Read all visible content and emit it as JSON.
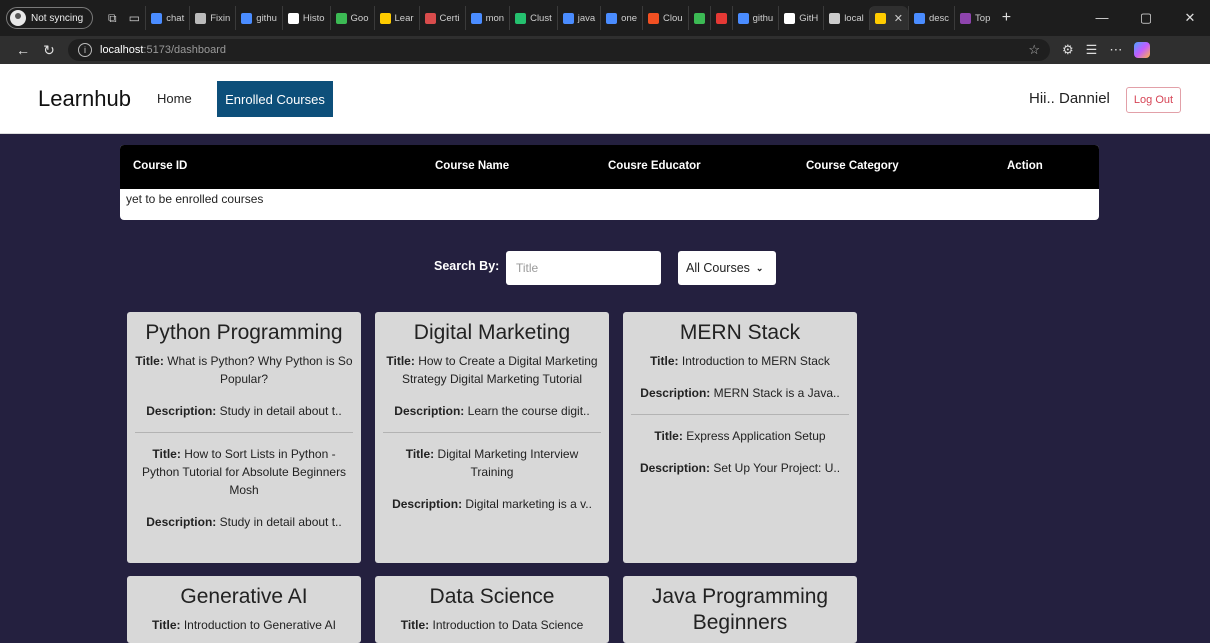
{
  "browser": {
    "profile_label": "Not syncing",
    "tabs": [
      {
        "label": "chat",
        "color": "#4a8cff"
      },
      {
        "label": "Fixin",
        "color": "#bbbbbb"
      },
      {
        "label": "githu",
        "color": "#4a8cff"
      },
      {
        "label": "Histo",
        "color": "#ffffff"
      },
      {
        "label": "Goo",
        "color": "#3cba54"
      },
      {
        "label": "Lear",
        "color": "#ffcc00"
      },
      {
        "label": "Certi",
        "color": "#d94c4c"
      },
      {
        "label": "mon",
        "color": "#4a8cff"
      },
      {
        "label": "Clust",
        "color": "#25c16f"
      },
      {
        "label": "java",
        "color": "#4a8cff"
      },
      {
        "label": "one",
        "color": "#4a8cff"
      },
      {
        "label": "Clou",
        "color": "#f25022"
      },
      {
        "label": "",
        "color": "#3cba54"
      },
      {
        "label": "",
        "color": "#e53935"
      },
      {
        "label": "githu",
        "color": "#4a8cff"
      },
      {
        "label": "GitH",
        "color": "#ffffff"
      },
      {
        "label": "local",
        "color": "#cccccc"
      },
      {
        "label": "",
        "color": "#ffcc00",
        "active": true
      },
      {
        "label": "desc",
        "color": "#4a8cff"
      },
      {
        "label": "Top",
        "color": "#8e44ad"
      }
    ],
    "url_host": "localhost",
    "url_path": ":5173/dashboard"
  },
  "header": {
    "brand": "Learnhub",
    "nav_home": "Home",
    "nav_enrolled": "Enrolled Courses",
    "greeting": "Hii.. Danniel",
    "logout": "Log Out"
  },
  "table": {
    "headers": [
      "Course ID",
      "Course Name",
      "Cousre Educator",
      "Course Category",
      "Action"
    ],
    "empty_message": "yet to be enrolled courses"
  },
  "search": {
    "label": "Search By:",
    "placeholder": "Title",
    "select_value": "All Courses"
  },
  "labels": {
    "title": "Title:",
    "description": "Description:"
  },
  "courses": [
    {
      "name": "Python Programming",
      "lessons": [
        {
          "title": "What is Python? Why Python is So Popular?",
          "desc": "Study in detail about t.."
        },
        {
          "title": "How to Sort Lists in Python - Python Tutorial for Absolute Beginners Mosh",
          "desc": "Study in detail about t.."
        }
      ]
    },
    {
      "name": "Digital Marketing",
      "lessons": [
        {
          "title": "How to Create a Digital Marketing Strategy Digital Marketing Tutorial",
          "desc": "Learn the course digit.."
        },
        {
          "title": "Digital Marketing Interview Training",
          "desc": "Digital marketing is a v.."
        }
      ]
    },
    {
      "name": "MERN Stack",
      "lessons": [
        {
          "title": "Introduction to MERN Stack",
          "desc": "MERN Stack is a Java.."
        },
        {
          "title": "Express Application Setup",
          "desc": "Set Up Your Project: U.."
        }
      ]
    },
    {
      "name": "Generative AI",
      "lessons": [
        {
          "title": "Introduction to Generative AI",
          "desc": ""
        }
      ]
    },
    {
      "name": "Data Science",
      "lessons": [
        {
          "title": "Introduction to Data Science",
          "desc": ""
        }
      ]
    },
    {
      "name": "Java Programming Beginners",
      "lessons": []
    }
  ]
}
